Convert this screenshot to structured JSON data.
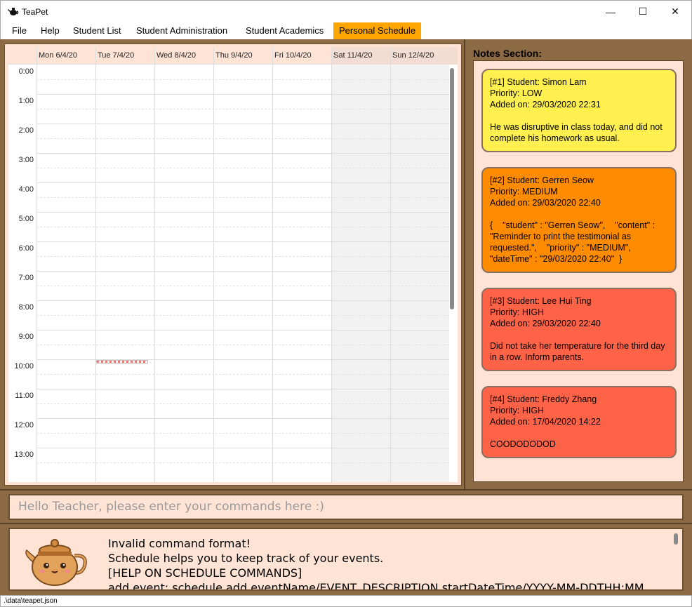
{
  "window": {
    "title": "TeaPet",
    "minimize": "—",
    "maximize": "☐",
    "close": "✕"
  },
  "menu": {
    "items": [
      "File",
      "Help",
      "Student List",
      "Student Administration",
      "Student Academics",
      "Personal Schedule"
    ],
    "active_index": 5,
    "active_color": "#ffa500"
  },
  "calendar": {
    "days": [
      "Mon 6/4/20",
      "Tue 7/4/20",
      "Wed 8/4/20",
      "Thu 9/4/20",
      "Fri 10/4/20",
      "Sat 11/4/20",
      "Sun 12/4/20"
    ],
    "times": [
      "0:00",
      "1:00",
      "2:00",
      "3:00",
      "4:00",
      "5:00",
      "6:00",
      "7:00",
      "8:00",
      "9:00",
      "10:00",
      "11:00",
      "12:00",
      "13:00"
    ]
  },
  "notes": {
    "title": "Notes Section:",
    "items": [
      {
        "header": "[#1] Student: Simon Lam",
        "priority": "Priority: LOW",
        "added": "Added on: 29/03/2020 22:31",
        "content": "He was disruptive in class today, and did not complete his homework as usual.",
        "color": "#fff050"
      },
      {
        "header": "[#2] Student: Gerren Seow",
        "priority": "Priority: MEDIUM",
        "added": "Added on: 29/03/2020 22:40",
        "content": "{    \"student\" : \"Gerren Seow\",    \"content\" : \"Reminder to print the testimonial as requested.\",    \"priority\" : \"MEDIUM\",    \"dateTime\" : \"29/03/2020 22:40\"  }",
        "color": "#ff8c00"
      },
      {
        "header": "[#3] Student: Lee Hui Ting",
        "priority": "Priority: HIGH",
        "added": "Added on: 29/03/2020 22:40",
        "content": "Did not take her temperature for the third day in a row. Inform parents.",
        "color": "#ff6347"
      },
      {
        "header": "[#4] Student: Freddy Zhang",
        "priority": "Priority: HIGH",
        "added": "Added on: 17/04/2020 14:22",
        "content": "COODODODOD",
        "color": "#ff6347"
      }
    ]
  },
  "command": {
    "placeholder": "Hello Teacher, please enter your commands here :)"
  },
  "result": {
    "text": "Invalid command format!\nSchedule helps you to keep track of your events.\n[HELP ON SCHEDULE COMMANDS]\nadd event: schedule add eventName/EVENT_DESCRIPTION startDateTime/YYYY-MM-DDTHH:MM"
  },
  "status": {
    "path": ".\\data\\teapet.json"
  }
}
